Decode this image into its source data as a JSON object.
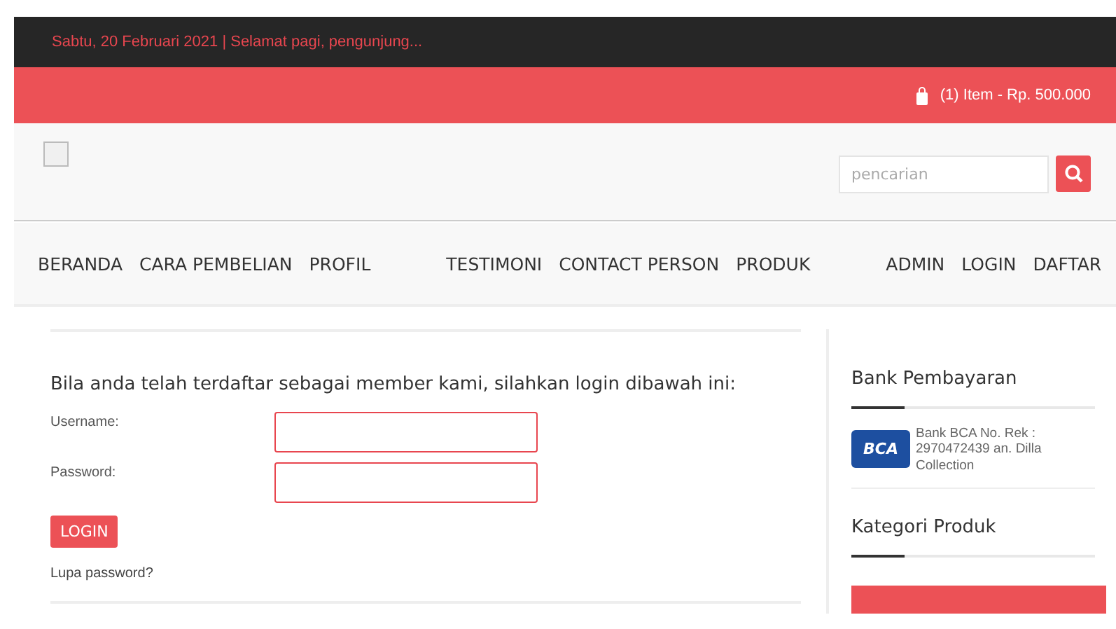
{
  "topbar": {
    "text": "Sabtu, 20 Februari 2021 | Selamat pagi, pengunjung..."
  },
  "cart": {
    "text": "(1) Item - Rp. 500.000"
  },
  "search": {
    "placeholder": "pencarian"
  },
  "nav": [
    {
      "label": "BERANDA"
    },
    {
      "label": "CARA PEMBELIAN"
    },
    {
      "label": "PROFIL"
    },
    {
      "label": "TESTIMONI"
    },
    {
      "label": "CONTACT PERSON"
    },
    {
      "label": "PRODUK"
    },
    {
      "label": "ADMIN"
    },
    {
      "label": "LOGIN"
    },
    {
      "label": "DAFTAR"
    }
  ],
  "login": {
    "intro": "Bila anda telah terdaftar sebagai member kami, silahkan login dibawah ini:",
    "fields": [
      {
        "label": "Username:"
      },
      {
        "label": "Password:"
      }
    ],
    "button": "LOGIN",
    "forgot": "Lupa password?"
  },
  "sidebar": {
    "bank_title": "Bank Pembayaran",
    "bank_logo": "BCA",
    "bank_text": "Bank BCA No. Rek : 2970472439 an. Dilla Collection",
    "category_title": "Kategori Produk"
  }
}
